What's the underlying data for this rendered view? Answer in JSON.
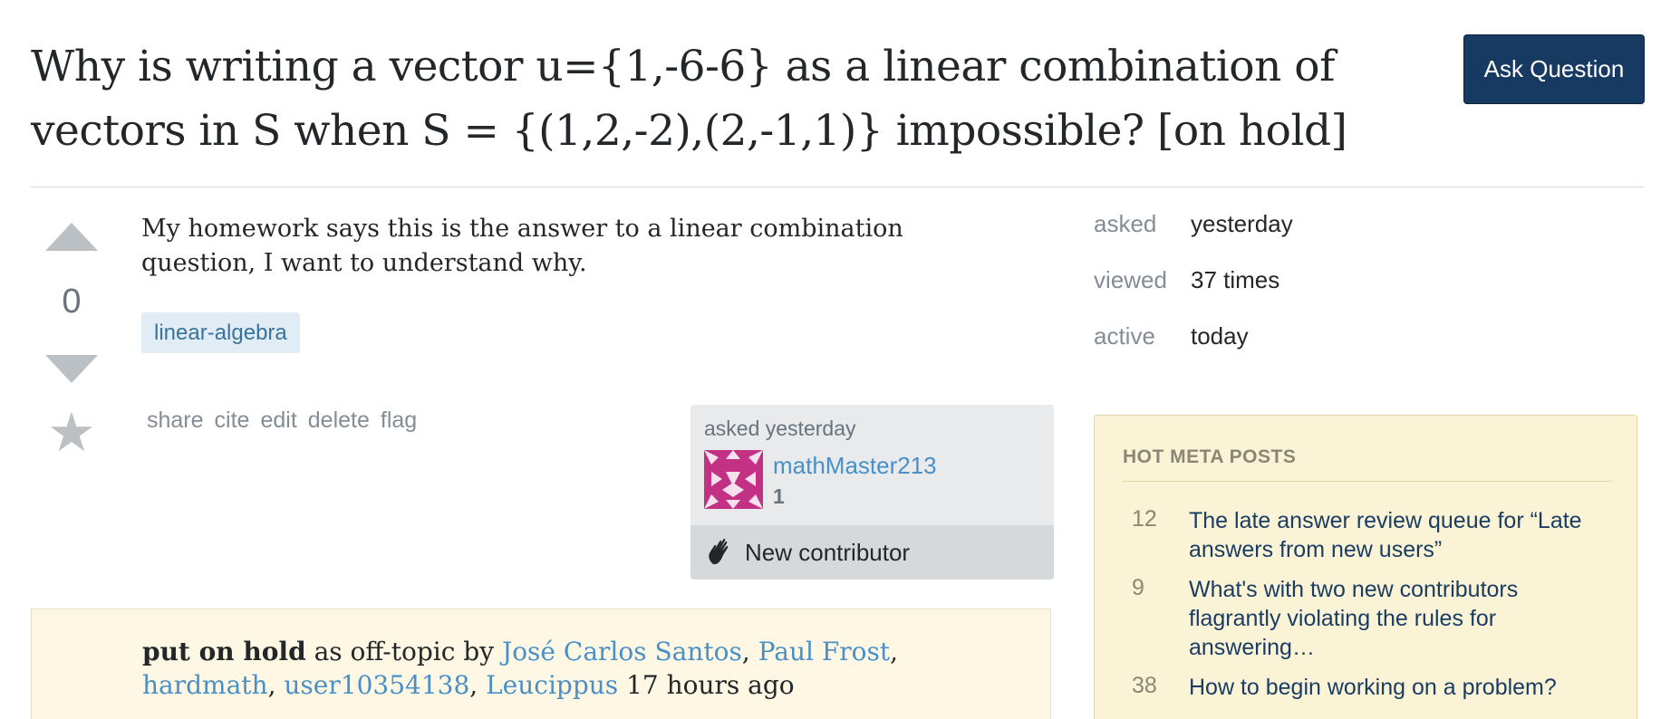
{
  "question": {
    "title": "Why is writing a vector u={1,-6-6} as a linear combination of vectors in S when S = {(1,2,-2),(2,-1,1)} impossible? [on hold]",
    "body": "My homework says this is the answer to a linear combination question, I want to understand why.",
    "votes": "0",
    "tags": [
      "linear-algebra"
    ]
  },
  "header": {
    "ask_button": "Ask Question"
  },
  "post_menu": [
    "share",
    "cite",
    "edit",
    "delete",
    "flag"
  ],
  "owner": {
    "asked_label": "asked yesterday",
    "name": "mathMaster213",
    "reputation": "1",
    "contributor_label": "New contributor"
  },
  "hold": {
    "status": "put on hold",
    "reason": "as off-topic by",
    "users": [
      "José Carlos Santos",
      "Paul Frost",
      "hardmath",
      "user10354138",
      "Leucippus"
    ],
    "time": "17 hours ago"
  },
  "stats": [
    {
      "label": "asked",
      "value": "yesterday"
    },
    {
      "label": "viewed",
      "value": "37 times"
    },
    {
      "label": "active",
      "value": "today"
    }
  ],
  "meta": {
    "header": "HOT META POSTS",
    "posts": [
      {
        "count": "12",
        "title": "The late answer review queue for “Late answers from new users”"
      },
      {
        "count": "9",
        "title": "What's with two new contributors flagrantly violating the rules for answering…"
      },
      {
        "count": "38",
        "title": "How to begin working on a problem?"
      }
    ]
  },
  "colors": {
    "accent": "#163a61",
    "link": "#4a90c8",
    "tag_bg": "#e1ecf4",
    "notice_bg": "#fdf7e3",
    "meta_bg": "#fbf3d5"
  }
}
